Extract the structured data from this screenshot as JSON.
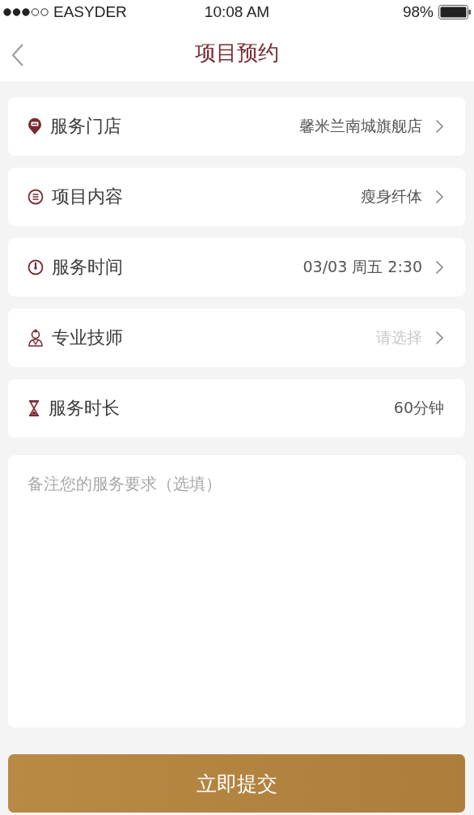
{
  "status_bar": {
    "carrier": "EASYDER",
    "time": "10:08 AM",
    "battery": "98%"
  },
  "nav": {
    "title": "项目预约"
  },
  "rows": [
    {
      "label": "服务门店",
      "value": "馨米兰南城旗舰店",
      "empty": false,
      "arrow": true
    },
    {
      "label": "项目内容",
      "value": "瘦身纤体",
      "empty": false,
      "arrow": true
    },
    {
      "label": "服务时间",
      "value": "03/03 周五 2:30",
      "empty": false,
      "arrow": true
    },
    {
      "label": "专业技师",
      "value": "请选择",
      "empty": true,
      "arrow": true
    },
    {
      "label": "服务时长",
      "value": "60分钟",
      "empty": false,
      "arrow": false
    }
  ],
  "notes": {
    "placeholder": "备注您的服务要求（选填）"
  },
  "submit": {
    "label": "立即提交"
  }
}
